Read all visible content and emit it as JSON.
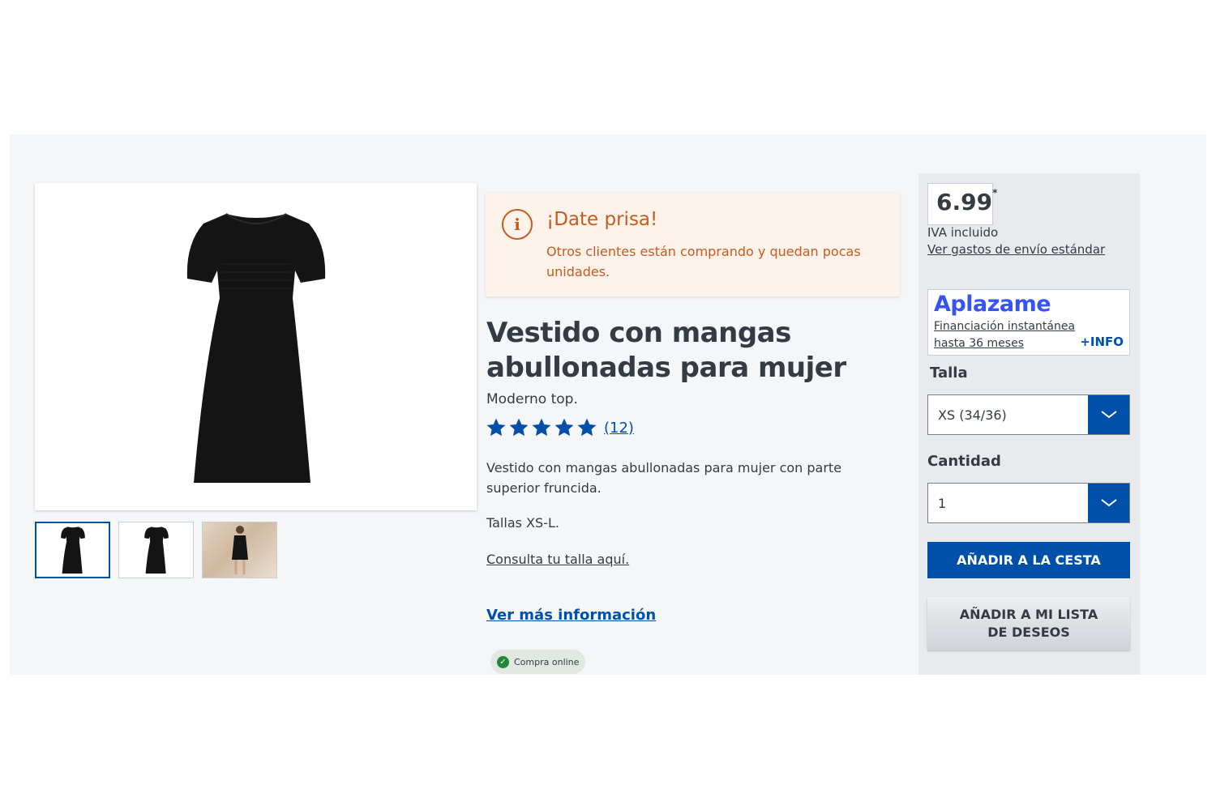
{
  "urgency": {
    "title": "¡Date prisa!",
    "text": "Otros clientes están comprando y quedan pocas unidades."
  },
  "product": {
    "title": "Vestido con mangas abullonadas para mujer",
    "subtitle": "Moderno top.",
    "rating_stars": 5,
    "review_count": "(12)",
    "description": "Vestido con mangas abullonadas para mujer con parte superior fruncida.",
    "sizes_text": "Tallas XS-L.",
    "size_link": "Consulta tu talla aquí.",
    "more_info_link": "Ver más información",
    "badge": "Compra online"
  },
  "pricing": {
    "price": "6.99",
    "price_mark": "*",
    "vat": "IVA incluido",
    "shipping_link": "Ver gastos de envío estándar"
  },
  "aplazame": {
    "logo": "Aplazame",
    "financing": "Financiación instantánea hasta 36 meses",
    "more": "+INFO"
  },
  "size_select": {
    "label": "Talla",
    "value": "XS (34/36)"
  },
  "quantity_select": {
    "label": "Cantidad",
    "value": "1"
  },
  "buttons": {
    "add_to_cart": "AÑADIR A LA CESTA",
    "add_to_wishlist": "AÑADIR A MI LISTA DE DESEOS"
  },
  "colors": {
    "brand_blue": "#0050aa",
    "urgency_orange": "#c85a1e",
    "aplazame_blue": "#3853f4"
  }
}
